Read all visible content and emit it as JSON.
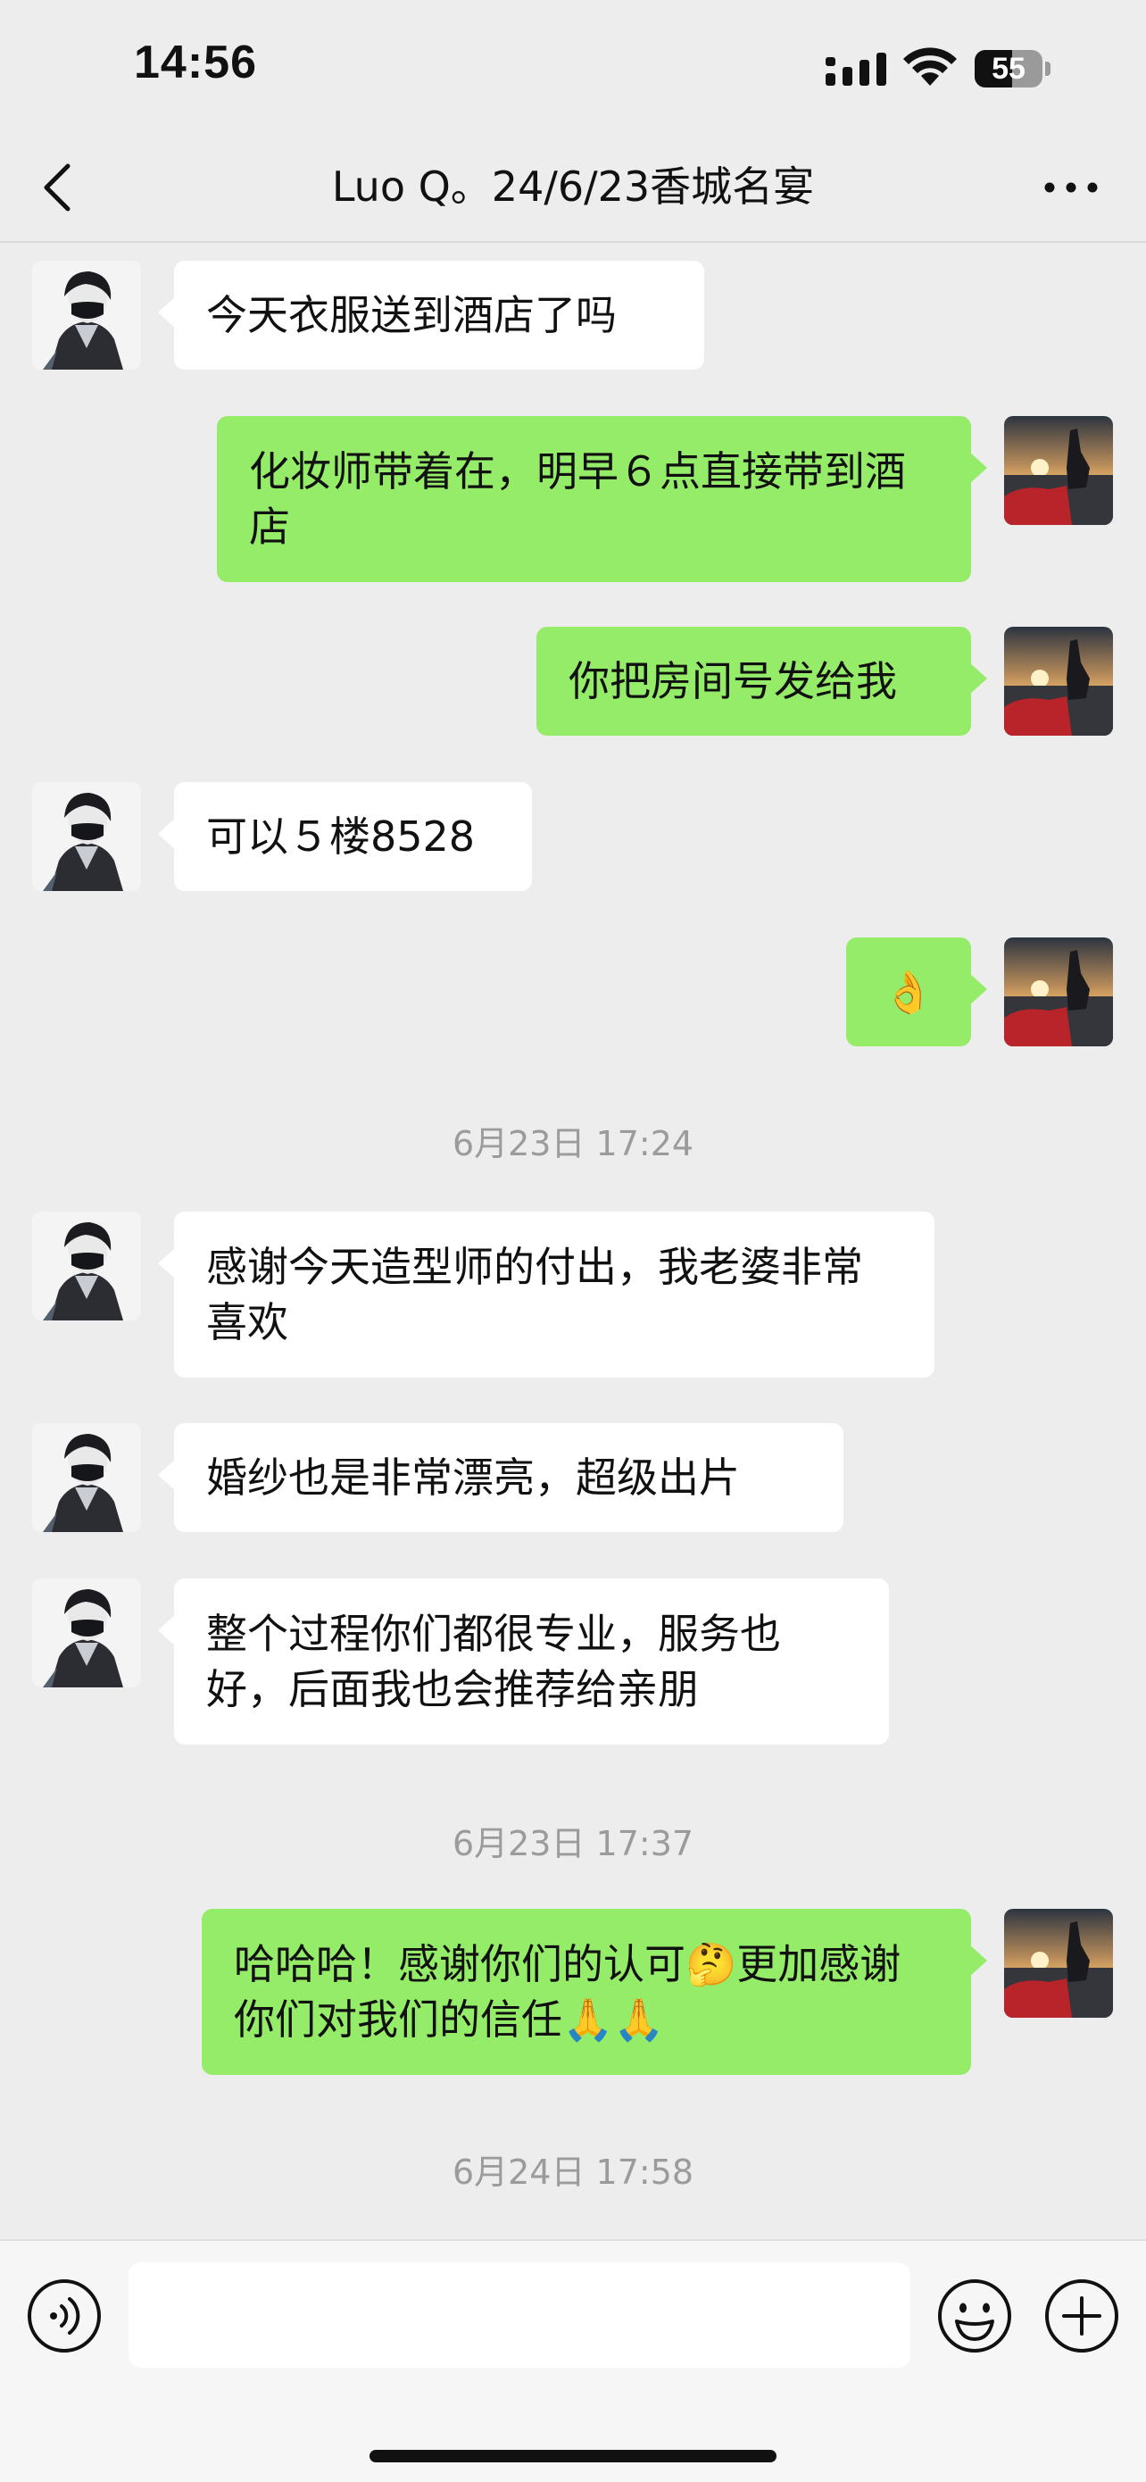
{
  "status_bar": {
    "time": "14:56",
    "battery": "55",
    "battery_level": 0.55
  },
  "header": {
    "title": "Luo Q。24/6/23香城名宴"
  },
  "messages": [
    {
      "side": "in",
      "text": "今天衣服送到酒店了吗"
    },
    {
      "side": "out",
      "text": "化妆师带着在，明早６点直接带到酒店"
    },
    {
      "side": "out",
      "text": "你把房间号发给我"
    },
    {
      "side": "in",
      "text": "可以５楼8528"
    },
    {
      "side": "out",
      "text": "👌"
    },
    {
      "side": "in",
      "text": "感谢今天造型师的付出，我老婆非常喜欢"
    },
    {
      "side": "in",
      "text": "婚纱也是非常漂亮，超级出片"
    },
    {
      "side": "in",
      "text": "整个过程你们都很专业，服务也好，后面我也会推荐给亲朋"
    },
    {
      "side": "out",
      "text": "哈哈哈！感谢你们的认可🤔更加感谢你们对我们的信任🙏🙏"
    }
  ],
  "timestamps": [
    "6月23日 17:24",
    "6月23日 17:37",
    "6月24日 17:58"
  ],
  "input": {
    "value": "",
    "placeholder": ""
  },
  "colors": {
    "background": "#ededed",
    "bubble_out": "#95ec69",
    "bubble_in": "#ffffff",
    "timestamp": "#9b9b9b"
  }
}
